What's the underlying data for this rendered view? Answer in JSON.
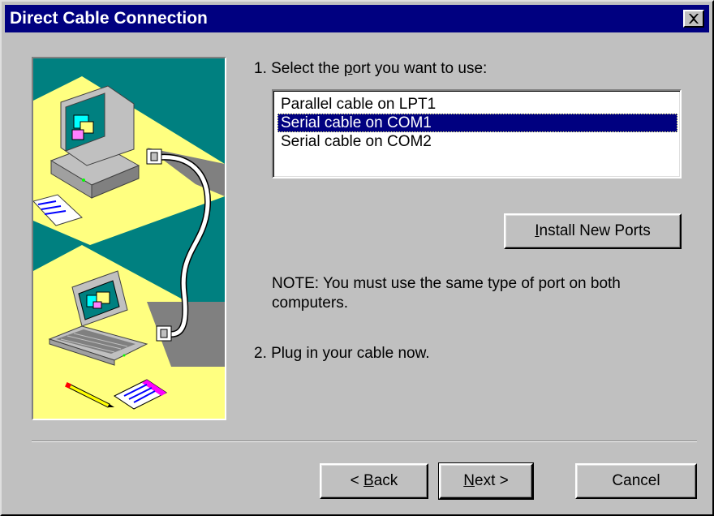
{
  "window": {
    "title": "Direct Cable Connection"
  },
  "colors": {
    "titlebar": "#000080",
    "face": "#c0c0c0",
    "selection": "#000080",
    "illustration_teal": "#008080",
    "illustration_yellow": "#ffff80"
  },
  "step1": {
    "prefix": "1. Select the ",
    "accel": "p",
    "suffix": "ort you want to use:"
  },
  "ports": {
    "items": [
      {
        "label": "Parallel cable on LPT1",
        "selected": false
      },
      {
        "label": "Serial cable on COM1",
        "selected": true
      },
      {
        "label": "Serial cable on COM2",
        "selected": false
      }
    ]
  },
  "install_button": {
    "accel": "I",
    "rest": "nstall New Ports"
  },
  "note": {
    "line1": "NOTE: You must use the same type of port on both",
    "line2": "computers."
  },
  "step2": {
    "text": "2. Plug in your cable now."
  },
  "footer": {
    "back": {
      "prefix": "< ",
      "accel": "B",
      "rest": "ack"
    },
    "next": {
      "accel": "N",
      "rest": "ext >"
    },
    "cancel": "Cancel"
  },
  "icons": {
    "close": "close-icon",
    "illustration": "pc-to-laptop-cable-illustration"
  }
}
